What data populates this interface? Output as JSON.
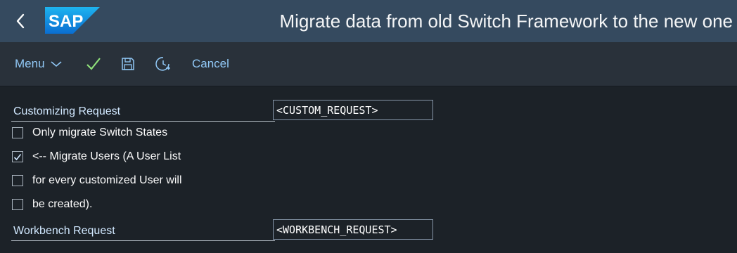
{
  "shell": {
    "logo_text": "SAP",
    "title": "Migrate data from old Switch Framework to the new one"
  },
  "toolbar": {
    "menu_label": "Menu",
    "cancel_label": "Cancel"
  },
  "form": {
    "customizing_label": "Customizing Request",
    "customizing_value": "<CUSTOM_REQUEST>",
    "options": [
      {
        "label": "Only migrate Switch States",
        "checked": false
      },
      {
        "label": "<-- Migrate Users (A User List",
        "checked": true
      },
      {
        "label": "for every customized User will",
        "checked": false
      },
      {
        "label": "be created).",
        "checked": false
      }
    ],
    "workbench_label": "Workbench Request",
    "workbench_value": "<WORKBENCH_REQUEST>"
  },
  "colors": {
    "shell_bg": "#354a5f",
    "toolbar_bg": "#29313a",
    "page_bg": "#1c2228",
    "link": "#91c8f6",
    "check_green": "#8fe07a"
  }
}
